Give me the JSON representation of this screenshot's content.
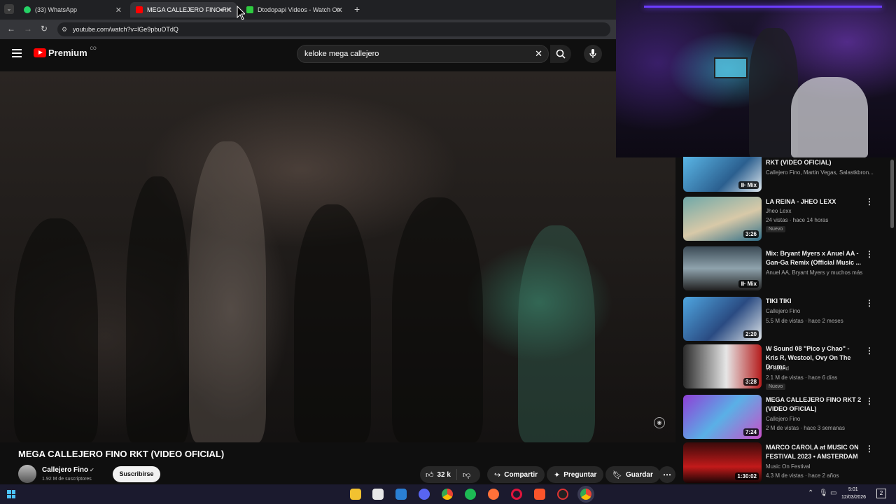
{
  "browser": {
    "tabs": [
      {
        "title": "(33) WhatsApp",
        "color": "#25d366"
      },
      {
        "title": "MEGA CALLEJERO FINO RK",
        "color": "#ff0000"
      },
      {
        "title": "Dtodopapi Videos - Watch On",
        "color": "#2ecc40"
      }
    ],
    "url": "youtube.com/watch?v=lGe9pbuOTdQ"
  },
  "youtube": {
    "logo": "Premium",
    "logo_country": "CO",
    "search_value": "keloke  mega callejero"
  },
  "video": {
    "title": "MEGA CALLEJERO FINO RKT (VIDEO OFICIAL)",
    "channel": "Callejero Fino",
    "subscribers": "1.92 M de suscriptores",
    "subscribe_label": "Suscribirse",
    "likes": "32 k",
    "share_label": "Compartir",
    "ask_label": "Preguntar",
    "save_label": "Guardar"
  },
  "recommendations": [
    {
      "title": "RKT (VIDEO OFICIAL)",
      "channel": "Callejero Fino, Martin Vegas, Salastkbron...",
      "stats": "",
      "badge": "Mix",
      "new": false
    },
    {
      "title": "LA REINA - JHEO LEXX",
      "channel": "Jheo Lexx",
      "stats": "24 vistas · hace 14 horas",
      "badge": "3:26",
      "new": true,
      "new_label": "Nuevo"
    },
    {
      "title": "Mix: Bryant Myers x Anuel AA - Gan-Ga Remix (Official Music ...",
      "channel": "Anuel AA, Bryant Myers y muchos más",
      "stats": "",
      "badge": "Mix",
      "new": false
    },
    {
      "title": "TIKI TIKI",
      "channel": "Callejero Fino",
      "stats": "5.5 M de vistas · hace 2 meses",
      "badge": "2:20",
      "new": false
    },
    {
      "title": "W Sound 08 \"Pico y Chao\" - Kris R, Westcol, Ovy On The Drums",
      "channel": "W Sound",
      "stats": "2.1 M de vistas · hace 6 días",
      "badge": "3:28",
      "new": true,
      "new_label": "Nuevo"
    },
    {
      "title": "MEGA CALLEJERO FINO RKT 2 (VIDEO OFICIAL)",
      "channel": "Callejero Fino",
      "stats": "2 M de vistas · hace 3 semanas",
      "badge": "7:24",
      "new": false
    },
    {
      "title": "MARCO CAROLA at MUSIC ON FESTIVAL 2023 • AMSTERDAM",
      "channel": "Music On Festival",
      "stats": "4.3 M de vistas · hace 2 años",
      "badge": "1:30:02",
      "new": false
    }
  ],
  "taskbar": {
    "time": "5:01",
    "date": "12/03/2026",
    "notifications": "2"
  },
  "colors": {
    "bg": "#0f0f0f",
    "accent": "#ff0000"
  }
}
